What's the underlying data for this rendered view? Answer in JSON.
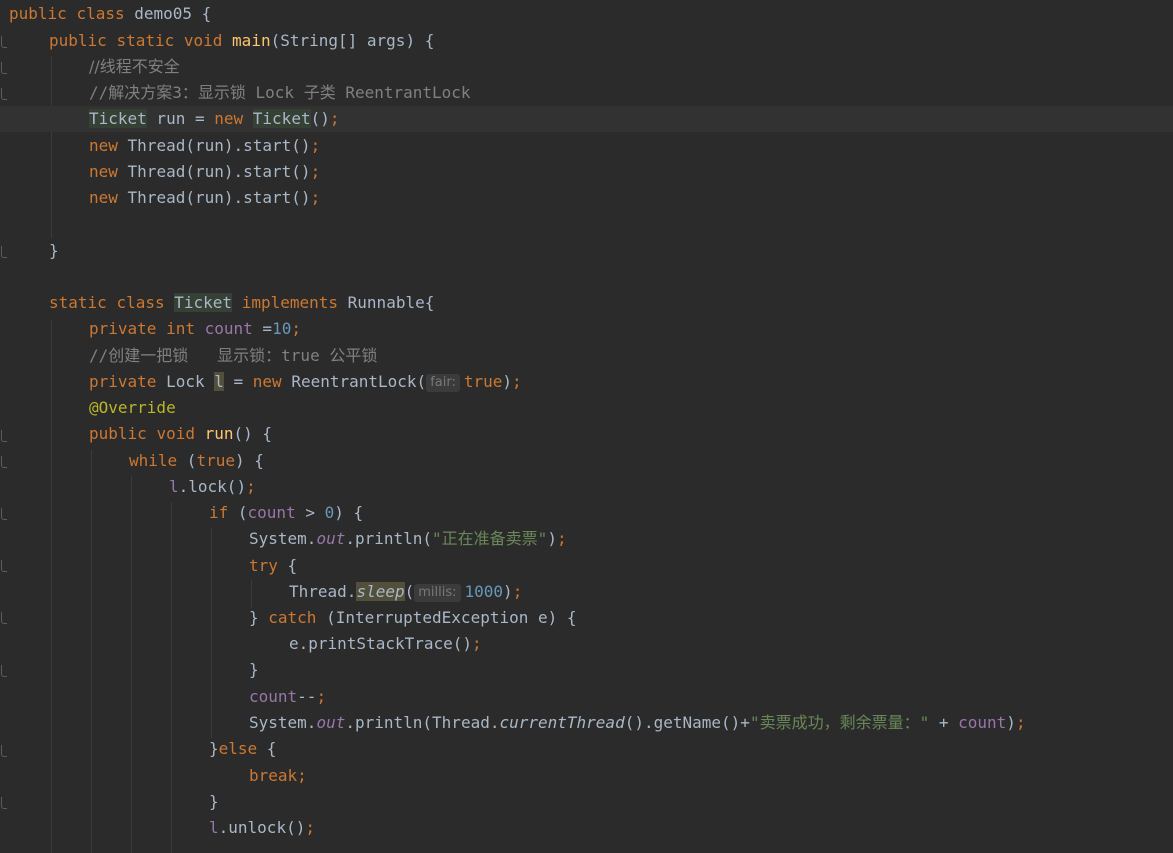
{
  "colors": {
    "background": "#2b2b2b",
    "keyword": "#cc7832",
    "method_declaration": "#ffc66d",
    "comment": "#808080",
    "number": "#6897bb",
    "string": "#6a8759",
    "field": "#9876aa",
    "annotation": "#bbb529",
    "plain": "#a9b7c6"
  },
  "code": {
    "l01": {
      "kw_public": "public",
      "kw_class": "class",
      "class_name": "demo05 {"
    },
    "l02": {
      "kw_public": "public",
      "kw_static": "static",
      "kw_void": "void",
      "method": "main",
      "rest": "(String[] args) {"
    },
    "l03": {
      "comment": "//线程不安全"
    },
    "l04": {
      "comment": "//解决方案3：显示锁 Lock 子类 ReentrantLock"
    },
    "l05": {
      "type": "Ticket",
      "mid": " run = ",
      "kw_new": "new",
      "type2": "Ticket",
      "rest": "()",
      "semi": ";"
    },
    "l06": {
      "kw_new": "new",
      "rest": " Thread(run).start()",
      "semi": ";"
    },
    "l07": {
      "kw_new": "new",
      "rest": " Thread(run).start()",
      "semi": ";"
    },
    "l08": {
      "kw_new": "new",
      "rest": " Thread(run).start()",
      "semi": ";"
    },
    "l10": {
      "brace": "}"
    },
    "l12": {
      "kw_static": "static",
      "kw_class": "class",
      "class_name": "Ticket",
      "kw_implements": "implements",
      "rest": "Runnable{"
    },
    "l13": {
      "kw_private": "private",
      "kw_int": "int",
      "field": "count",
      "eq": " =",
      "num": "10",
      "semi": ";"
    },
    "l14": {
      "comment": "//创建一把锁   显示锁：true 公平锁"
    },
    "l15": {
      "kw_private": "private",
      "type": " Lock ",
      "var": "l",
      "mid": " = ",
      "kw_new": "new",
      "rest": " ReentrantLock(",
      "hint": "fair:",
      "kw_true": "true",
      "close": ")",
      "semi": ";"
    },
    "l16": {
      "annotation": "@Override"
    },
    "l17": {
      "kw_public": "public",
      "kw_void": "void",
      "method": "run",
      "rest": "() {"
    },
    "l18": {
      "kw_while": "while",
      "open": " (",
      "kw_true": "true",
      "rest": ") {"
    },
    "l19": {
      "var": "l",
      "rest": ".lock()",
      "semi": ";"
    },
    "l20": {
      "kw_if": "if",
      "open": " (",
      "field": "count",
      "op": " > ",
      "num": "0",
      "rest": ") {"
    },
    "l21": {
      "pre": "System.",
      "static_field": "out",
      "mid": ".println(",
      "str": "\"正在准备卖票\"",
      "close": ")",
      "semi": ";"
    },
    "l22": {
      "kw_try": "try",
      "rest": " {"
    },
    "l23": {
      "pre": "Thread.",
      "method": "sleep",
      "open": "(",
      "hint": "millis:",
      "num": "1000",
      "close": ")",
      "semi": ";"
    },
    "l24": {
      "pre": "} ",
      "kw_catch": "catch",
      "rest": " (InterruptedException e) {"
    },
    "l25": {
      "rest": "e.printStackTrace()",
      "semi": ";"
    },
    "l26": {
      "brace": "}"
    },
    "l27": {
      "field": "count",
      "rest": "--",
      "semi": ";"
    },
    "l28": {
      "pre": "System.",
      "static_field": "out",
      "mid": ".println(Thread.",
      "static_method": "currentThread",
      "mid2": "().getName()+",
      "str": "\"卖票成功，剩余票量：\"",
      "plus": " + ",
      "field": "count",
      "close": ")",
      "semi": ";"
    },
    "l29": {
      "pre": "}",
      "kw_else": "else",
      "rest": " {"
    },
    "l30": {
      "kw_break": "break",
      "semi": ";"
    },
    "l31": {
      "brace": "}"
    },
    "l32": {
      "var": "l",
      "rest": ".unlock()",
      "semi": ";"
    }
  }
}
